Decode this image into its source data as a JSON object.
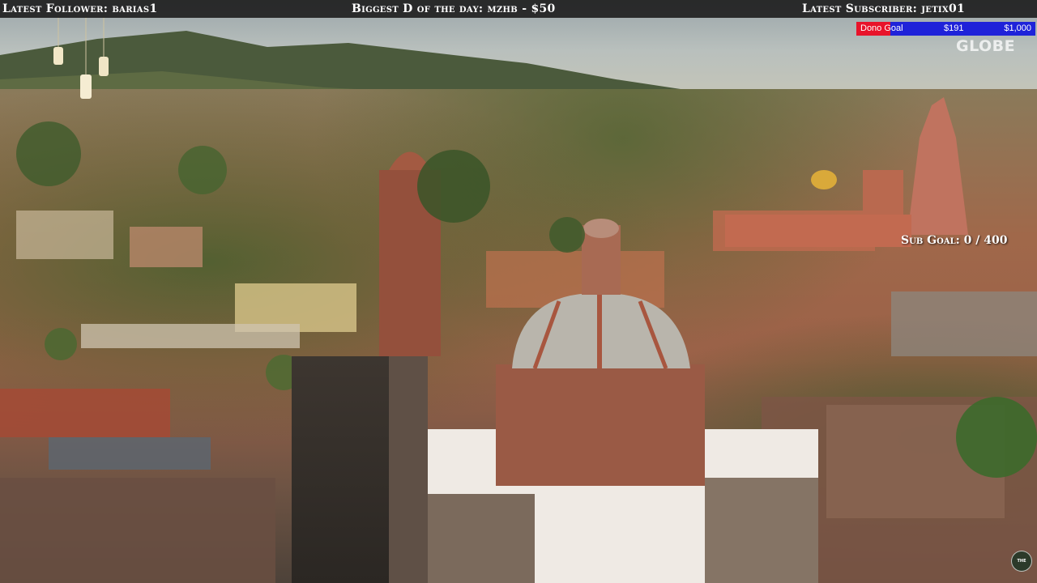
{
  "ticker": {
    "latest_follower": "Latest Follower: barias1",
    "biggest_donation": "Biggest D of the day: mzhb - $50",
    "latest_subscriber": "Latest Subscriber: jetix01"
  },
  "dono_goal": {
    "title": "Dono Goal",
    "current": "$191",
    "target": "$1,000",
    "progress_fraction": 0.191,
    "fill_color": "#e8132a",
    "track_color": "#1f22d9"
  },
  "watermark": {
    "logo_text": "GLOBE"
  },
  "sub_goal": {
    "text": "Sub Goal: 0 / 400"
  },
  "corner_badge": {
    "logo_text": "THE GLOBE"
  },
  "colors": {
    "ticker_bar": "#202020",
    "ticker_text": "#ffffff"
  }
}
